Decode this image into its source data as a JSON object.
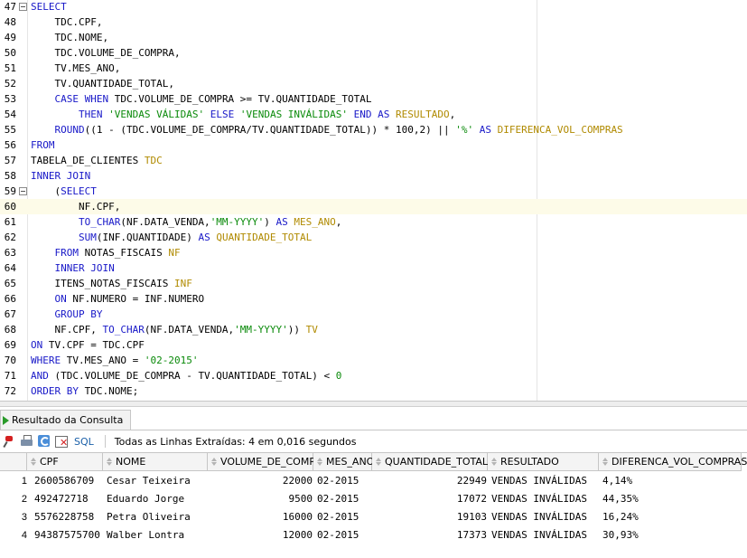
{
  "editor": {
    "lines": [
      {
        "num": "47",
        "fold": true,
        "tokens": [
          {
            "t": "SELECT",
            "c": "kw"
          }
        ]
      },
      {
        "num": "48",
        "tokens": [
          {
            "t": "    TDC.CPF,"
          }
        ]
      },
      {
        "num": "49",
        "tokens": [
          {
            "t": "    TDC.NOME,"
          }
        ]
      },
      {
        "num": "50",
        "tokens": [
          {
            "t": "    TDC.VOLUME_DE_COMPRA,"
          }
        ]
      },
      {
        "num": "51",
        "tokens": [
          {
            "t": "    TV.MES_ANO,"
          }
        ]
      },
      {
        "num": "52",
        "tokens": [
          {
            "t": "    TV.QUANTIDADE_TOTAL,"
          }
        ]
      },
      {
        "num": "53",
        "tokens": [
          {
            "t": "    "
          },
          {
            "t": "CASE WHEN",
            "c": "kw"
          },
          {
            "t": " TDC.VOLUME_DE_COMPRA >= TV.QUANTIDADE_TOTAL"
          }
        ]
      },
      {
        "num": "54",
        "tokens": [
          {
            "t": "        "
          },
          {
            "t": "THEN",
            "c": "kw"
          },
          {
            "t": " "
          },
          {
            "t": "'VENDAS VÁLIDAS'",
            "c": "str"
          },
          {
            "t": " "
          },
          {
            "t": "ELSE",
            "c": "kw"
          },
          {
            "t": " "
          },
          {
            "t": "'VENDAS INVÁLIDAS'",
            "c": "str"
          },
          {
            "t": " "
          },
          {
            "t": "END AS",
            "c": "kw"
          },
          {
            "t": " "
          },
          {
            "t": "RESULTADO",
            "c": "al"
          },
          {
            "t": ","
          }
        ]
      },
      {
        "num": "55",
        "tokens": [
          {
            "t": "    "
          },
          {
            "t": "ROUND",
            "c": "kw"
          },
          {
            "t": "((1 - (TDC.VOLUME_DE_COMPRA/TV.QUANTIDADE_TOTAL)) * 100,2) || "
          },
          {
            "t": "'%'",
            "c": "str"
          },
          {
            "t": " "
          },
          {
            "t": "AS",
            "c": "kw"
          },
          {
            "t": " "
          },
          {
            "t": "DIFERENCA_VOL_COMPRAS",
            "c": "al"
          }
        ]
      },
      {
        "num": "56",
        "tokens": [
          {
            "t": "FROM",
            "c": "kw"
          }
        ]
      },
      {
        "num": "57",
        "tokens": [
          {
            "t": "TABELA_DE_CLIENTES "
          },
          {
            "t": "TDC",
            "c": "al"
          }
        ]
      },
      {
        "num": "58",
        "tokens": [
          {
            "t": "INNER JOIN",
            "c": "kw"
          }
        ]
      },
      {
        "num": "59",
        "fold": true,
        "tokens": [
          {
            "t": "    ("
          },
          {
            "t": "SELECT",
            "c": "kw"
          }
        ]
      },
      {
        "num": "60",
        "hl": true,
        "tokens": [
          {
            "t": "        NF.CPF,"
          }
        ]
      },
      {
        "num": "61",
        "tokens": [
          {
            "t": "        "
          },
          {
            "t": "TO_CHAR",
            "c": "kw"
          },
          {
            "t": "(NF.DATA_VENDA,"
          },
          {
            "t": "'MM-YYYY'",
            "c": "str"
          },
          {
            "t": ") "
          },
          {
            "t": "AS",
            "c": "kw"
          },
          {
            "t": " "
          },
          {
            "t": "MES_ANO",
            "c": "al"
          },
          {
            "t": ","
          }
        ]
      },
      {
        "num": "62",
        "tokens": [
          {
            "t": "        "
          },
          {
            "t": "SUM",
            "c": "kw"
          },
          {
            "t": "(INF.QUANTIDADE) "
          },
          {
            "t": "AS",
            "c": "kw"
          },
          {
            "t": " "
          },
          {
            "t": "QUANTIDADE_TOTAL",
            "c": "al"
          }
        ]
      },
      {
        "num": "63",
        "tokens": [
          {
            "t": "    "
          },
          {
            "t": "FROM",
            "c": "kw"
          },
          {
            "t": " NOTAS_FISCAIS "
          },
          {
            "t": "NF",
            "c": "al"
          }
        ]
      },
      {
        "num": "64",
        "tokens": [
          {
            "t": "    "
          },
          {
            "t": "INNER JOIN",
            "c": "kw"
          }
        ]
      },
      {
        "num": "65",
        "tokens": [
          {
            "t": "    ITENS_NOTAS_FISCAIS "
          },
          {
            "t": "INF",
            "c": "al"
          }
        ]
      },
      {
        "num": "66",
        "tokens": [
          {
            "t": "    "
          },
          {
            "t": "ON",
            "c": "kw"
          },
          {
            "t": " NF.NUMERO = INF.NUMERO"
          }
        ]
      },
      {
        "num": "67",
        "tokens": [
          {
            "t": "    "
          },
          {
            "t": "GROUP BY",
            "c": "kw"
          }
        ]
      },
      {
        "num": "68",
        "tokens": [
          {
            "t": "    NF.CPF, "
          },
          {
            "t": "TO_CHAR",
            "c": "kw"
          },
          {
            "t": "(NF.DATA_VENDA,"
          },
          {
            "t": "'MM-YYYY'",
            "c": "str"
          },
          {
            "t": ")) "
          },
          {
            "t": "TV",
            "c": "al"
          }
        ]
      },
      {
        "num": "69",
        "tokens": [
          {
            "t": "ON",
            "c": "kw"
          },
          {
            "t": " TV.CPF = TDC.CPF"
          }
        ]
      },
      {
        "num": "70",
        "tokens": [
          {
            "t": "WHERE",
            "c": "kw"
          },
          {
            "t": " TV.MES_ANO = "
          },
          {
            "t": "'02-2015'",
            "c": "str"
          }
        ]
      },
      {
        "num": "71",
        "tokens": [
          {
            "t": "AND",
            "c": "kw"
          },
          {
            "t": " (TDC.VOLUME_DE_COMPRA - TV.QUANTIDADE_TOTAL) < "
          },
          {
            "t": "0",
            "c": "str"
          }
        ]
      },
      {
        "num": "72",
        "tokens": [
          {
            "t": "ORDER BY",
            "c": "kw"
          },
          {
            "t": " TDC.NOME;"
          }
        ]
      }
    ]
  },
  "results": {
    "tab_label": "Resultado da Consulta",
    "sql_label": "SQL",
    "status": "Todas as Linhas Extraídas: 4 em 0,016 segundos",
    "columns": [
      "CPF",
      "NOME",
      "VOLUME_DE_COMPRA",
      "MES_ANO",
      "QUANTIDADE_TOTAL",
      "RESULTADO",
      "DIFERENCA_VOL_COMPRAS"
    ],
    "rows": [
      {
        "n": "1",
        "cells": [
          "2600586709",
          "Cesar Teixeira",
          "22000",
          "02-2015",
          "22949",
          "VENDAS INVÁLIDAS",
          "4,14%"
        ]
      },
      {
        "n": "2",
        "cells": [
          "492472718",
          "Eduardo Jorge",
          "9500",
          "02-2015",
          "17072",
          "VENDAS INVÁLIDAS",
          "44,35%"
        ]
      },
      {
        "n": "3",
        "cells": [
          "5576228758",
          "Petra Oliveira",
          "16000",
          "02-2015",
          "19103",
          "VENDAS INVÁLIDAS",
          "16,24%"
        ]
      },
      {
        "n": "4",
        "cells": [
          "94387575700",
          "Walber Lontra",
          "12000",
          "02-2015",
          "17373",
          "VENDAS INVÁLIDAS",
          "30,93%"
        ]
      }
    ]
  }
}
